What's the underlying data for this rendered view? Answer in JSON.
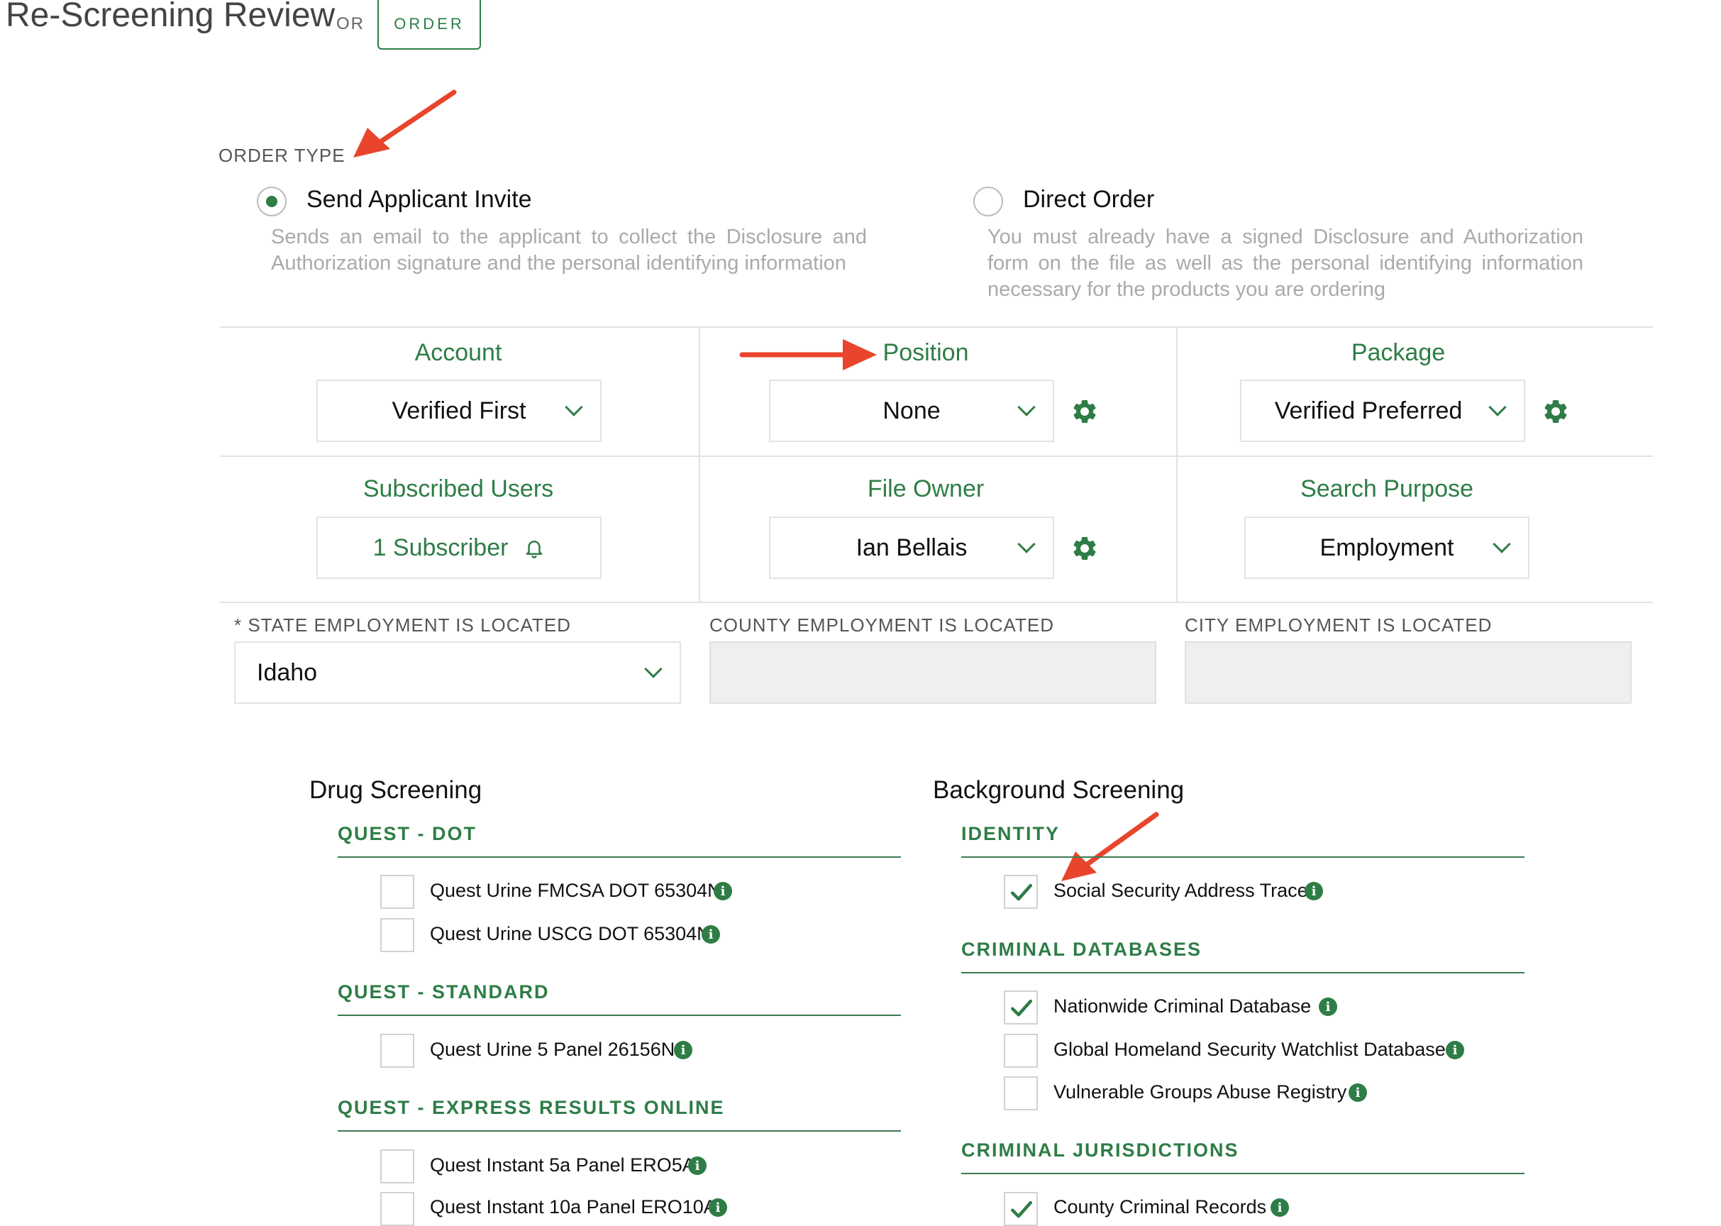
{
  "header": {
    "title": "Re-Screening Review",
    "or_text": "OR",
    "order_button": "ORDER"
  },
  "order_type": {
    "label": "ORDER TYPE",
    "options": [
      {
        "label": "Send Applicant Invite",
        "description": "Sends an email to the applicant to collect the Disclosure and Authorization signature and the personal identifying information",
        "selected": true
      },
      {
        "label": "Direct Order",
        "description": "You must already have a signed Disclosure and Authorization form on the file as well as the personal identifying information necessary for the products you are ordering",
        "selected": false
      }
    ]
  },
  "fields": {
    "account": {
      "label": "Account",
      "value": "Verified First"
    },
    "position": {
      "label": "Position",
      "value": "None"
    },
    "package": {
      "label": "Package",
      "value": "Verified Preferred"
    },
    "subscribed_users": {
      "label": "Subscribed Users",
      "value": "1 Subscriber"
    },
    "file_owner": {
      "label": "File Owner",
      "value": "Ian Bellais"
    },
    "search_purpose": {
      "label": "Search Purpose",
      "value": "Employment"
    }
  },
  "location": {
    "state": {
      "label": "* STATE EMPLOYMENT IS LOCATED",
      "value": "Idaho"
    },
    "county": {
      "label": "COUNTY EMPLOYMENT IS LOCATED",
      "value": ""
    },
    "city": {
      "label": "CITY EMPLOYMENT IS LOCATED",
      "value": ""
    }
  },
  "drug_screening": {
    "title": "Drug Screening",
    "groups": [
      {
        "title": "QUEST - DOT",
        "items": [
          {
            "label": "Quest Urine FMCSA DOT 65304N",
            "checked": false
          },
          {
            "label": "Quest Urine USCG DOT 65304N",
            "checked": false
          }
        ]
      },
      {
        "title": "QUEST - STANDARD",
        "items": [
          {
            "label": "Quest Urine 5 Panel 26156N",
            "checked": false
          }
        ]
      },
      {
        "title": "QUEST - EXPRESS RESULTS ONLINE",
        "items": [
          {
            "label": "Quest Instant 5a Panel ERO5A",
            "checked": false
          },
          {
            "label": "Quest Instant 10a Panel ERO10A",
            "checked": false
          }
        ]
      }
    ]
  },
  "background_screening": {
    "title": "Background Screening",
    "groups": [
      {
        "title": "IDENTITY",
        "items": [
          {
            "label": "Social Security Address Trace",
            "checked": true
          }
        ]
      },
      {
        "title": "CRIMINAL DATABASES",
        "items": [
          {
            "label": "Nationwide Criminal Database",
            "checked": true
          },
          {
            "label": "Global Homeland Security Watchlist Database",
            "checked": false
          },
          {
            "label": "Vulnerable Groups Abuse Registry",
            "checked": false
          }
        ]
      },
      {
        "title": "CRIMINAL JURISDICTIONS",
        "items": [
          {
            "label": "County Criminal Records",
            "checked": true
          }
        ]
      }
    ]
  },
  "icons": {
    "info": "info-icon",
    "settings": "gear-icon",
    "dropdown": "chevron-down-icon",
    "subscriber": "bell-icon",
    "annotation": "red-arrow-icon"
  },
  "colors": {
    "brand_green": "#2e7d46",
    "annotation_red": "#e8452c",
    "muted_text": "#aaaaaa"
  }
}
